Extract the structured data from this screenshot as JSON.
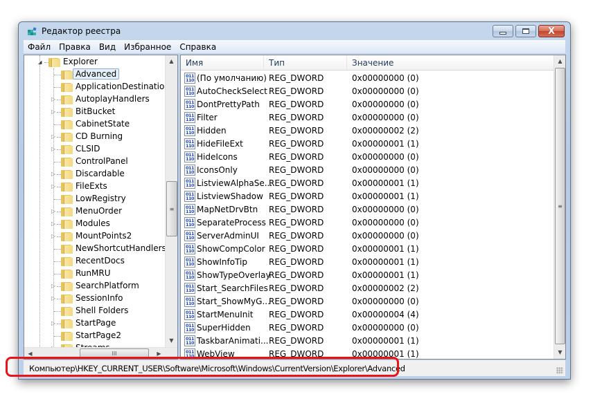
{
  "window": {
    "title": "Редактор реестра",
    "app_icon": "registry-editor-icon",
    "controls": {
      "minimize": "minimize-icon",
      "maximize": "maximize-icon",
      "close": "close-icon",
      "close_glyph": "X"
    }
  },
  "menubar": [
    "Файл",
    "Правка",
    "Вид",
    "Избранное",
    "Справка"
  ],
  "tree": {
    "parent": {
      "label": "Explorer",
      "expanded": true
    },
    "children": [
      {
        "label": "Advanced",
        "selected": true,
        "has_children": false
      },
      {
        "label": "ApplicationDestinations",
        "has_children": false
      },
      {
        "label": "AutoplayHandlers",
        "has_children": true
      },
      {
        "label": "BitBucket",
        "has_children": true
      },
      {
        "label": "CabinetState",
        "has_children": false
      },
      {
        "label": "CD Burning",
        "has_children": true
      },
      {
        "label": "CLSID",
        "has_children": true
      },
      {
        "label": "ControlPanel",
        "has_children": false
      },
      {
        "label": "Discardable",
        "has_children": true
      },
      {
        "label": "FileExts",
        "has_children": true
      },
      {
        "label": "LowRegistry",
        "has_children": false
      },
      {
        "label": "MenuOrder",
        "has_children": true
      },
      {
        "label": "Modules",
        "has_children": true
      },
      {
        "label": "MountPoints2",
        "has_children": true
      },
      {
        "label": "NewShortcutHandlers",
        "has_children": false
      },
      {
        "label": "RecentDocs",
        "has_children": false
      },
      {
        "label": "RunMRU",
        "has_children": false
      },
      {
        "label": "SearchPlatform",
        "has_children": true
      },
      {
        "label": "SessionInfo",
        "has_children": true
      },
      {
        "label": "Shell Folders",
        "has_children": false
      },
      {
        "label": "StartPage",
        "has_children": true
      },
      {
        "label": "StartPage2",
        "has_children": false
      },
      {
        "label": "Streams",
        "has_children": true
      }
    ],
    "scroll": {
      "up_arrow": "▲",
      "down_arrow": "▼",
      "left_arrow": "◀",
      "right_arrow": "▶",
      "grip": "≡",
      "hgrip": "III"
    }
  },
  "list": {
    "columns": [
      "Имя",
      "Тип",
      "Значение"
    ],
    "icon": "reg-dword-icon",
    "icon_glyph": "011\n110",
    "rows": [
      {
        "name": "(По умолчанию)",
        "type": "REG_DWORD",
        "value": "0x00000000 (0)"
      },
      {
        "name": "AutoCheckSelect",
        "type": "REG_DWORD",
        "value": "0x00000000 (0)"
      },
      {
        "name": "DontPrettyPath",
        "type": "REG_DWORD",
        "value": "0x00000000 (0)"
      },
      {
        "name": "Filter",
        "type": "REG_DWORD",
        "value": "0x00000000 (0)"
      },
      {
        "name": "Hidden",
        "type": "REG_DWORD",
        "value": "0x00000002 (2)"
      },
      {
        "name": "HideFileExt",
        "type": "REG_DWORD",
        "value": "0x00000001 (1)"
      },
      {
        "name": "HideIcons",
        "type": "REG_DWORD",
        "value": "0x00000000 (0)"
      },
      {
        "name": "IconsOnly",
        "type": "REG_DWORD",
        "value": "0x00000000 (0)"
      },
      {
        "name": "ListviewAlphaSe...",
        "type": "REG_DWORD",
        "value": "0x00000001 (1)"
      },
      {
        "name": "ListviewShadow",
        "type": "REG_DWORD",
        "value": "0x00000001 (1)"
      },
      {
        "name": "MapNetDrvBtn",
        "type": "REG_DWORD",
        "value": "0x00000000 (0)"
      },
      {
        "name": "SeparateProcess",
        "type": "REG_DWORD",
        "value": "0x00000000 (0)"
      },
      {
        "name": "ServerAdminUI",
        "type": "REG_DWORD",
        "value": "0x00000000 (0)"
      },
      {
        "name": "ShowCompColor",
        "type": "REG_DWORD",
        "value": "0x00000001 (1)"
      },
      {
        "name": "ShowInfoTip",
        "type": "REG_DWORD",
        "value": "0x00000001 (1)"
      },
      {
        "name": "ShowTypeOverlay",
        "type": "REG_DWORD",
        "value": "0x00000001 (1)"
      },
      {
        "name": "Start_SearchFiles",
        "type": "REG_DWORD",
        "value": "0x00000002 (2)"
      },
      {
        "name": "Start_ShowMyG...",
        "type": "REG_DWORD",
        "value": "0x00000000 (0)"
      },
      {
        "name": "StartMenuInit",
        "type": "REG_DWORD",
        "value": "0x00000004 (4)"
      },
      {
        "name": "SuperHidden",
        "type": "REG_DWORD",
        "value": "0x00000000 (0)"
      },
      {
        "name": "TaskbarAnimati...",
        "type": "REG_DWORD",
        "value": "0x00000001 (1)"
      },
      {
        "name": "WebView",
        "type": "REG_DWORD",
        "value": "0x00000001 (1)"
      }
    ]
  },
  "statusbar": {
    "path": "Компьютер\\HKEY_CURRENT_USER\\Software\\Microsoft\\Windows\\CurrentVersion\\Explorer\\Advanced",
    "highlight_color": "#e8141a"
  }
}
